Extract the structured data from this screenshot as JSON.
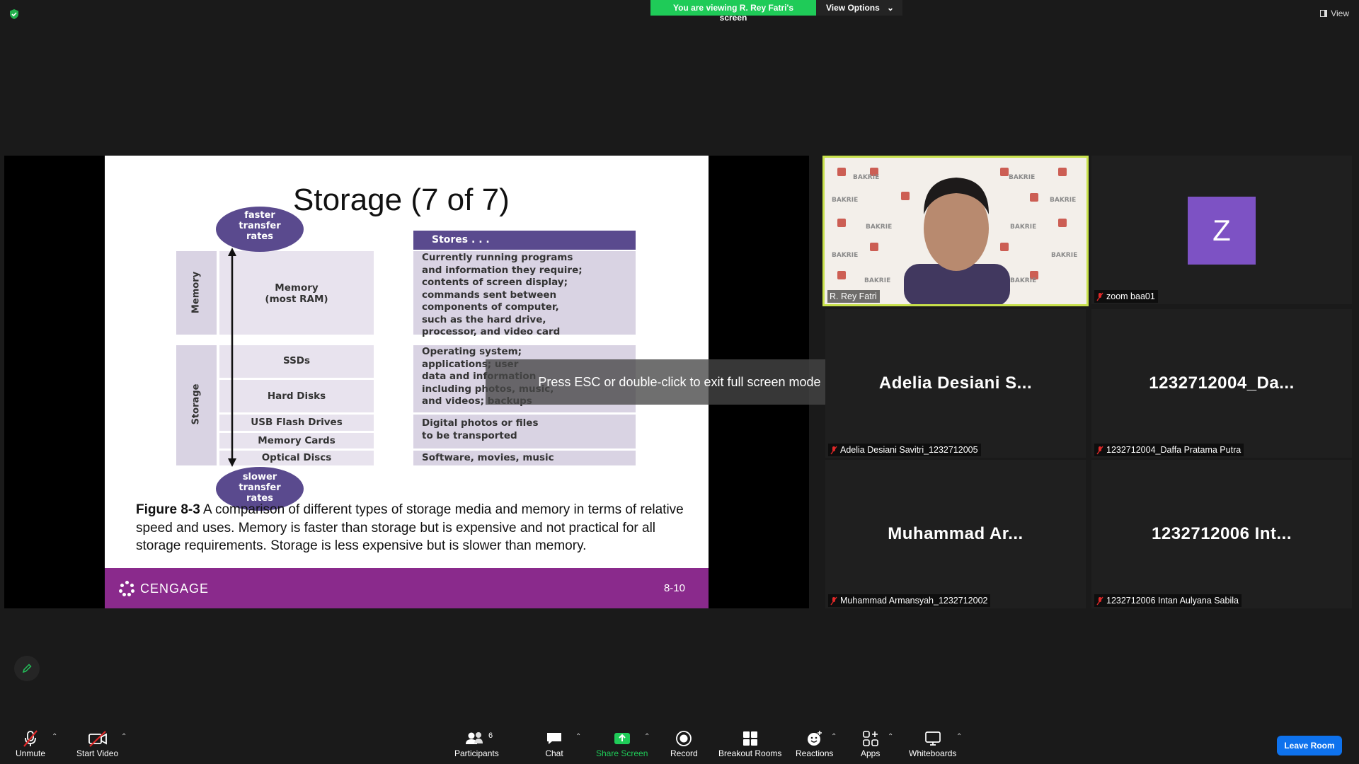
{
  "top": {
    "viewing_banner": "You are viewing R. Rey Fatri's screen",
    "view_options": "View Options",
    "view_label": "View"
  },
  "slide": {
    "title": "Storage (7 of 7)",
    "oval_top": [
      "faster",
      "transfer",
      "rates"
    ],
    "oval_bottom": [
      "slower",
      "transfer",
      "rates"
    ],
    "stores_header": "Stores . . .",
    "memory_group": "Memory",
    "storage_group": "Storage",
    "rows": {
      "memory": [
        "Memory",
        "(most RAM)"
      ],
      "ssds": "SSDs",
      "hard_disks": "Hard Disks",
      "usb": "USB Flash Drives",
      "memory_cards": "Memory Cards",
      "optical": "Optical Discs"
    },
    "desc": {
      "memory": [
        "Currently running programs",
        "and information they require;",
        "contents of screen display;",
        "commands sent between",
        "components of computer,",
        "such as the hard drive,",
        "processor, and video card"
      ],
      "storage": [
        "Operating system;",
        "applications; user",
        "data and information",
        "including photos, music,",
        "and videos; backups"
      ],
      "digital": [
        "Digital photos or files",
        "to be transported"
      ],
      "software": "Software, movies, music"
    },
    "caption_bold": "Figure 8-3",
    "caption": " A comparison of different types of storage media and memory in terms of relative speed and uses. Memory is faster than storage but is expensive and not practical for all storage requirements. Storage is less expensive but is slower than memory.",
    "brand": "CENGAGE",
    "page": "8-10"
  },
  "overlay": {
    "esc_message": "Press ESC or double-click to exit full screen mode"
  },
  "participants": [
    {
      "tag": "R. Rey Fatri"
    },
    {
      "tag": "zoom baa01",
      "avatar": "Z"
    },
    {
      "big": "Adelia Desiani S...",
      "tag": "Adelia Desiani Savitri_1232712005"
    },
    {
      "big": "1232712004_Da...",
      "tag": "1232712004_Daffa Pratama Putra"
    },
    {
      "big": "Muhammad Ar...",
      "tag": "Muhammad Armansyah_1232712002"
    },
    {
      "big": "1232712006 Int...",
      "tag": "1232712006 Intan Aulyana Sabila"
    }
  ],
  "toolbar": {
    "unmute": "Unmute",
    "start_video": "Start Video",
    "participants": "Participants",
    "participants_count": "6",
    "chat": "Chat",
    "share_screen": "Share Screen",
    "record": "Record",
    "breakout_rooms": "Breakout Rooms",
    "reactions": "Reactions",
    "apps": "Apps",
    "whiteboards": "Whiteboards",
    "leave": "Leave Room"
  },
  "colors": {
    "share_green": "#1fcb58",
    "active_speaker": "#c8e14b",
    "slide_footer": "#8a2a8c",
    "leave_blue": "#0e72ed",
    "avatar_purple": "#7d52c4"
  }
}
